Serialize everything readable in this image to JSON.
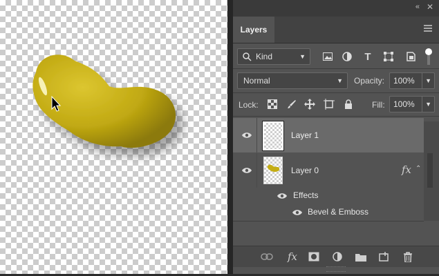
{
  "panel": {
    "tab_label": "Layers",
    "filter": {
      "kind_label": "Kind"
    },
    "blend_mode": "Normal",
    "opacity_label": "Opacity:",
    "opacity_value": "100%",
    "lock_label": "Lock:",
    "fill_label": "Fill:",
    "fill_value": "100%"
  },
  "layers": [
    {
      "name": "Layer 1",
      "selected": true
    },
    {
      "name": "Layer 0",
      "fx_label": "fx",
      "effects_label": "Effects",
      "effect_items": [
        "Bevel & Emboss"
      ]
    }
  ],
  "colors": {
    "blob": "#c4ad14",
    "panel": "#535353",
    "selection": "#6a6a6a"
  }
}
